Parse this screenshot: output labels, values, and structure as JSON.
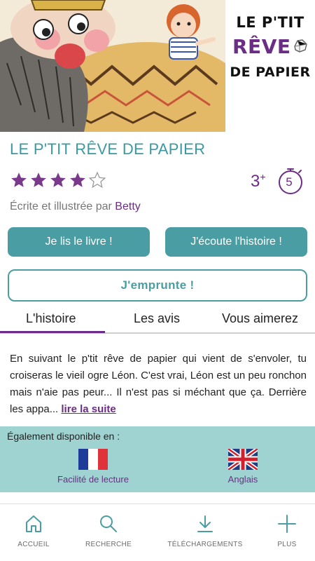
{
  "cover": {
    "title_line1": "LE P'TIT",
    "title_line2": "RÊVE",
    "title_line3": "DE PAPIER"
  },
  "book": {
    "title": "LE P'TIT RÊVE DE PAPIER",
    "rating": 4,
    "rating_max": 5,
    "age": "3",
    "age_suffix": "+",
    "duration": "5",
    "author_prefix": "Écrite et illustrée par",
    "author_name": "Betty"
  },
  "actions": {
    "read_label": "Je lis le livre !",
    "listen_label": "J'écoute l'histoire !",
    "borrow_label": "J'emprunte !"
  },
  "tabs": [
    {
      "label": "L'histoire",
      "active": true
    },
    {
      "label": "Les avis",
      "active": false
    },
    {
      "label": "Vous aimerez",
      "active": false
    }
  ],
  "story": {
    "text": "En suivant le p'tit rêve de papier qui vient de s'envoler, tu croiseras le vieil ogre Léon. C'est vrai, Léon est un peu ronchon mais n'aie pas peur... Il n'est pas si méchant que ça. Derrière les appa...",
    "more_label": "lire la suite"
  },
  "also_available": {
    "label": "Également disponible en :",
    "items": [
      {
        "label": "Facilité de lecture",
        "icon": "france-flag-icon"
      },
      {
        "label": "Anglais",
        "icon": "uk-flag-icon"
      }
    ]
  },
  "nav": [
    {
      "label": "ACCUEIL",
      "icon": "home-icon"
    },
    {
      "label": "RECHERCHE",
      "icon": "search-icon"
    },
    {
      "label": "TÉLÉCHARGEMENTS",
      "icon": "download-icon"
    },
    {
      "label": "PLUS",
      "icon": "plus-icon"
    }
  ],
  "colors": {
    "accent_teal": "#4a9ea3",
    "accent_purple": "#6b2d86",
    "panel": "#9fd3d2"
  }
}
